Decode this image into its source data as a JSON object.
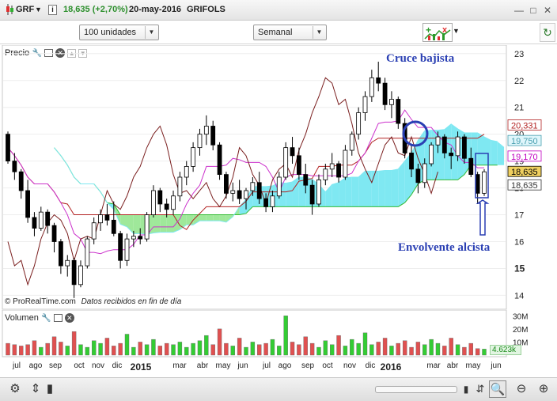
{
  "titlebar": {
    "symbol": "GRF",
    "price_change": "18,635 (+2,70%)",
    "date": "20-may-2016",
    "name": "GRIFOLS"
  },
  "toolbar": {
    "units_select": "100 unidades",
    "period_select": "Semanal"
  },
  "price_panel": {
    "title": "Precio",
    "footer": "© ProRealTime.com",
    "footer_note": "Datos recibidos en fin de día",
    "annotation_cross": "Cruce bajista",
    "annotation_engulfing": "Envolvente alcista",
    "y_ticks": [
      "23",
      "22",
      "21",
      "20",
      "19",
      "18",
      "17",
      "16",
      "15",
      "14"
    ],
    "price_labels": [
      {
        "text": "20,331",
        "color": "#b22222",
        "bg": "#ffffff"
      },
      {
        "text": "19,750",
        "color": "#4aa0b0",
        "bg": "#dff6fb"
      },
      {
        "text": "19,170",
        "color": "#c000c0",
        "bg": "#ffffff"
      },
      {
        "text": "18,635",
        "color": "#000000",
        "bg": "#f0d060"
      },
      {
        "text": "18,635",
        "color": "#333333",
        "bg": "#ffffff"
      }
    ],
    "colors": {
      "cloud_bull": "#7fe8f2",
      "cloud_bear": "#9fe89a",
      "tenkan": "#cc33cc",
      "kijun": "#b22222",
      "chikou": "#7a1e1e",
      "span_b": "#33bb33",
      "annotation": "#2a3fb3"
    }
  },
  "volume_panel": {
    "title": "Volumen",
    "y_ticks": [
      "30M",
      "20M",
      "10M"
    ],
    "last_value": "4.623k",
    "colors": {
      "up": "#33cc33",
      "down": "#e05050"
    }
  },
  "x_axis": {
    "labels": [
      "jul",
      "ago",
      "sep",
      "oct",
      "nov",
      "dic",
      "2015",
      "mar",
      "abr",
      "may",
      "jun",
      "jul",
      "ago",
      "sep",
      "oct",
      "nov",
      "dic",
      "2016",
      "mar",
      "abr",
      "may",
      "jun"
    ]
  },
  "chart_data": {
    "type": "candlestick",
    "title": "GRF",
    "ylim": [
      13.6,
      23.2
    ],
    "y_ticks": [
      23,
      22,
      21,
      20,
      19,
      18,
      17,
      16,
      15,
      14
    ],
    "candles_ohlc": [
      [
        20.0,
        20.1,
        18.9,
        19.0
      ],
      [
        19.0,
        19.3,
        18.3,
        18.6
      ],
      [
        18.6,
        18.7,
        17.6,
        17.9
      ],
      [
        17.9,
        18.3,
        16.7,
        16.9
      ],
      [
        16.9,
        17.1,
        16.2,
        16.5
      ],
      [
        16.5,
        17.3,
        16.4,
        17.1
      ],
      [
        17.1,
        17.2,
        16.3,
        16.6
      ],
      [
        16.6,
        16.7,
        15.6,
        16.0
      ],
      [
        16.0,
        16.1,
        14.8,
        15.1
      ],
      [
        15.1,
        15.5,
        14.7,
        15.3
      ],
      [
        15.3,
        15.4,
        13.9,
        14.4
      ],
      [
        14.4,
        15.3,
        14.3,
        15.1
      ],
      [
        15.1,
        16.2,
        15.0,
        16.1
      ],
      [
        16.1,
        16.9,
        15.9,
        16.7
      ],
      [
        16.7,
        17.2,
        16.4,
        17.0
      ],
      [
        17.0,
        17.4,
        16.6,
        16.8
      ],
      [
        16.8,
        17.5,
        16.2,
        16.3
      ],
      [
        16.3,
        16.4,
        15.0,
        15.3
      ],
      [
        15.3,
        16.3,
        15.1,
        16.1
      ],
      [
        16.1,
        16.4,
        15.8,
        16.2
      ],
      [
        16.2,
        16.5,
        15.9,
        16.1
      ],
      [
        16.1,
        17.1,
        16.0,
        17.0
      ],
      [
        17.0,
        18.1,
        16.9,
        17.9
      ],
      [
        17.9,
        18.0,
        17.1,
        17.4
      ],
      [
        17.4,
        17.6,
        16.9,
        17.2
      ],
      [
        17.2,
        17.9,
        17.0,
        17.7
      ],
      [
        17.7,
        18.6,
        17.5,
        18.4
      ],
      [
        18.4,
        19.0,
        18.1,
        18.8
      ],
      [
        18.8,
        19.7,
        18.6,
        19.5
      ],
      [
        19.5,
        20.2,
        19.2,
        20.0
      ],
      [
        20.0,
        20.7,
        19.6,
        20.3
      ],
      [
        20.3,
        20.5,
        19.4,
        19.6
      ],
      [
        19.6,
        19.7,
        18.3,
        18.5
      ],
      [
        18.5,
        18.6,
        17.6,
        17.8
      ],
      [
        17.8,
        18.2,
        17.5,
        17.9
      ],
      [
        17.9,
        18.3,
        17.4,
        17.6
      ],
      [
        17.6,
        18.0,
        17.2,
        17.9
      ],
      [
        17.9,
        18.4,
        17.7,
        18.2
      ],
      [
        18.2,
        18.6,
        17.4,
        17.6
      ],
      [
        17.6,
        17.8,
        17.1,
        17.3
      ],
      [
        17.3,
        17.9,
        17.1,
        17.7
      ],
      [
        17.7,
        18.6,
        17.6,
        18.4
      ],
      [
        18.4,
        19.7,
        18.3,
        19.5
      ],
      [
        19.5,
        19.9,
        18.9,
        19.2
      ],
      [
        19.2,
        19.5,
        18.3,
        18.5
      ],
      [
        18.5,
        18.9,
        17.8,
        18.1
      ],
      [
        18.1,
        18.3,
        17.0,
        17.4
      ],
      [
        17.4,
        18.5,
        17.3,
        18.3
      ],
      [
        18.3,
        18.9,
        18.1,
        18.7
      ],
      [
        18.7,
        19.3,
        18.4,
        18.9
      ],
      [
        18.9,
        19.0,
        18.2,
        18.4
      ],
      [
        18.4,
        19.6,
        18.3,
        19.4
      ],
      [
        19.4,
        20.1,
        19.2,
        20.0
      ],
      [
        20.0,
        21.0,
        19.8,
        20.8
      ],
      [
        20.8,
        21.6,
        20.5,
        21.4
      ],
      [
        21.4,
        22.4,
        21.2,
        22.1
      ],
      [
        22.1,
        22.7,
        21.6,
        21.9
      ],
      [
        21.9,
        22.1,
        20.9,
        21.1
      ],
      [
        21.1,
        21.6,
        20.6,
        21.3
      ],
      [
        21.3,
        21.4,
        20.2,
        20.4
      ],
      [
        20.4,
        20.6,
        19.1,
        19.3
      ],
      [
        19.3,
        19.6,
        18.4,
        18.7
      ],
      [
        18.7,
        18.9,
        17.8,
        18.2
      ],
      [
        18.2,
        19.1,
        18.0,
        18.9
      ],
      [
        18.9,
        19.7,
        18.8,
        19.6
      ],
      [
        19.6,
        20.1,
        19.3,
        19.9
      ],
      [
        19.9,
        20.0,
        19.1,
        19.3
      ],
      [
        19.3,
        19.5,
        18.7,
        19.2
      ],
      [
        19.2,
        20.1,
        19.0,
        19.9
      ],
      [
        19.9,
        20.0,
        18.9,
        19.1
      ],
      [
        19.1,
        19.5,
        18.4,
        18.5
      ],
      [
        18.5,
        18.6,
        17.4,
        17.8
      ],
      [
        17.8,
        18.7,
        17.7,
        18.6
      ]
    ]
  }
}
